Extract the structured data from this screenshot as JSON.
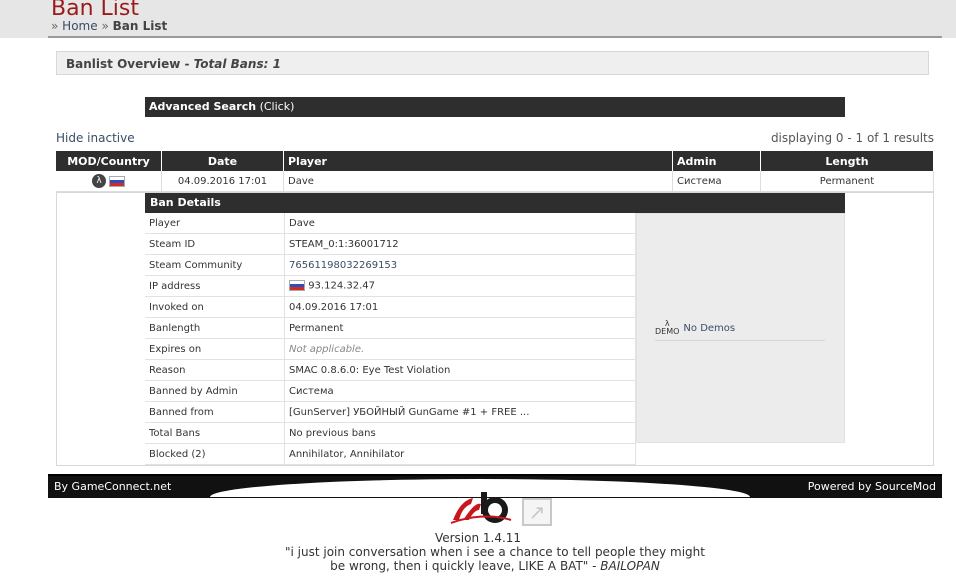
{
  "header": {
    "title": "Ban List",
    "breadcrumb": {
      "sep": "»",
      "home": "Home",
      "current": "Ban List"
    }
  },
  "overview": {
    "label": "Banlist Overview",
    "dash": " - ",
    "total": "Total Bans: 1"
  },
  "advanced_search": {
    "label": "Advanced Search",
    "hint": "(Click)"
  },
  "hide_inactive": "Hide inactive",
  "displaying": "displaying 0 - 1 of 1 results",
  "table": {
    "headers": [
      "MOD/Country",
      "Date",
      "Player",
      "Admin",
      "Length"
    ],
    "row": {
      "mod_icon": "halflife-icon",
      "country": "ru-flag",
      "date": "04.09.2016 17:01",
      "player": "Dave",
      "admin": "Система",
      "length": "Permanent"
    }
  },
  "details": {
    "title": "Ban Details",
    "rows": [
      {
        "label": "Player",
        "value": "Dave"
      },
      {
        "label": "Steam ID",
        "value": "STEAM_0:1:36001712"
      },
      {
        "label": "Steam Community",
        "value": "76561198032269153"
      },
      {
        "label": "IP address",
        "value": "93.124.32.47"
      },
      {
        "label": "Invoked on",
        "value": "04.09.2016 17:01"
      },
      {
        "label": "Banlength",
        "value": "Permanent"
      },
      {
        "label": "Expires on",
        "value": "Not applicable."
      },
      {
        "label": "Reason",
        "value": "SMAC 0.8.6.0: Eye Test Violation"
      },
      {
        "label": "Banned by Admin",
        "value": "Система"
      },
      {
        "label": "Banned from",
        "value": "[GunServer] УБОЙНЫЙ GunGame #1 + FREE ..."
      },
      {
        "label": "Total Bans",
        "value": "No previous bans"
      },
      {
        "label": "Blocked (2)",
        "value": "Annihilator, Annihilator"
      }
    ],
    "demo": {
      "icon_text": "λ\nDEMO",
      "label": "No Demos"
    }
  },
  "footer": {
    "left": "By GameConnect.net",
    "right": "Powered by SourceMod",
    "version": "Version 1.4.11",
    "quote": "\"i just join conversation when i see a chance to tell people they might be wrong, then i quickly leave, LIKE A BAT\"",
    "quote_sep": " - ",
    "quote_author": "BAILOPAN"
  },
  "colors": {
    "title_red": "#9b1b1b",
    "bar_dark": "#2e2e2e",
    "link_blue": "#3a4d66",
    "logo_red": "#c8161d"
  }
}
